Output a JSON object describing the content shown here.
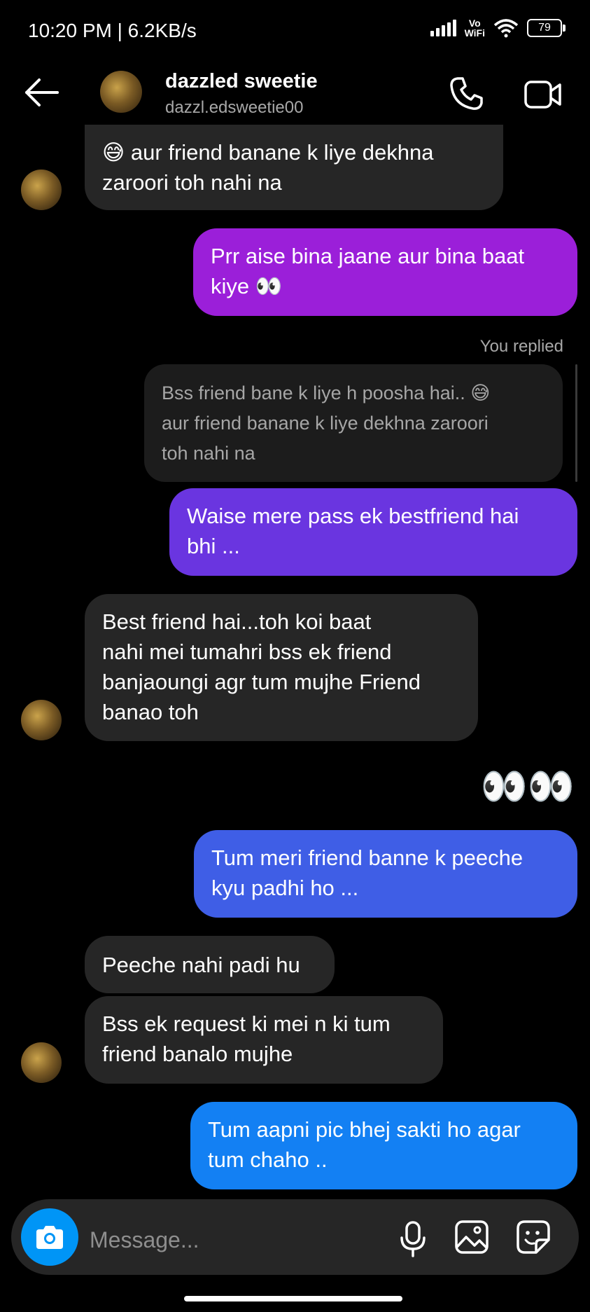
{
  "status_bar": {
    "time_speed": "10:20 PM | 6.2KB/s",
    "vowifi_top": "Vo",
    "vowifi_bottom": "WiFi",
    "battery": "79"
  },
  "header": {
    "name": "dazzled sweetie",
    "username": "dazzl.edsweetie00",
    "icons": [
      "back-arrow-icon",
      "phone-icon",
      "video-camera-icon"
    ]
  },
  "messages": {
    "m1_line1": "😅 aur friend banane k liye dekhna",
    "m1_line2": "zaroori toh nahi na",
    "m2_line1": "Prr aise bina jaane aur bina baat",
    "m2_line2": "kiye 👀",
    "reply_label": "You replied",
    "reply_line1": "Bss friend bane k liye h poosha hai.. 😅",
    "reply_line2": "aur friend banane k liye dekhna zaroori",
    "reply_line3": "toh nahi na",
    "m3_line1": "Waise mere pass ek bestfriend hai",
    "m3_line2": "bhi ...",
    "m4_line1": "Best friend hai...toh koi baat",
    "m4_line2": "nahi mei tumahri bss ek friend",
    "m4_line3": "banjaoungi agr tum mujhe Friend",
    "m4_line4": "banao toh",
    "m5": "👀👀",
    "m6_line1": "Tum meri friend banne k peeche",
    "m6_line2": "kyu padhi ho ...",
    "m7": "Peeche nahi padi hu",
    "m8_line1": "Bss ek request ki mei n ki tum",
    "m8_line2": "friend banalo mujhe",
    "m9_line1": "Tum aapni pic bhej sakti ho agar",
    "m9_line2": "tum chaho .."
  },
  "composer": {
    "placeholder": "Message...",
    "icons": [
      "camera-icon",
      "microphone-icon",
      "gallery-icon",
      "sticker-icon"
    ]
  },
  "colors": {
    "sent_gradient": [
      "#9b1fd9",
      "#7a2de0",
      "#5b4ae3",
      "#3a63e8",
      "#1a7ff2"
    ],
    "received": "#262626",
    "camera": "#0095f6",
    "background": "#000000"
  }
}
